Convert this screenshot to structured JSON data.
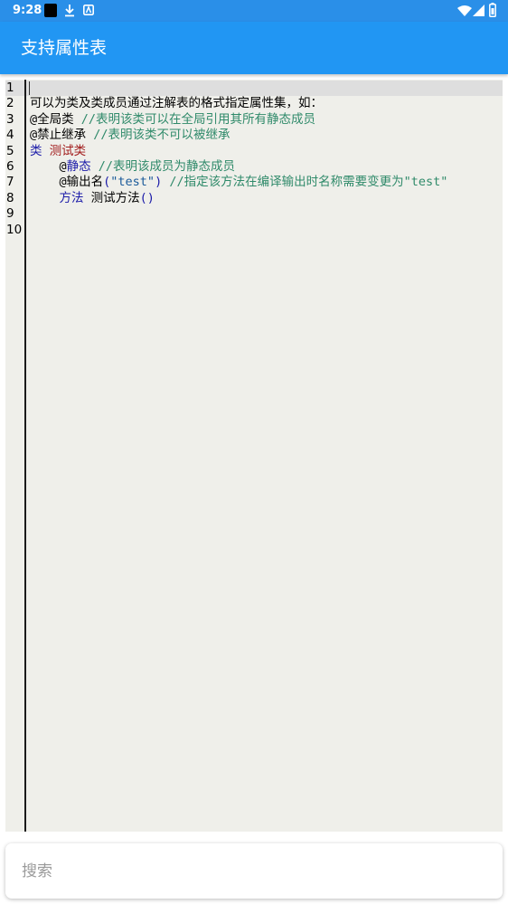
{
  "status_bar": {
    "time": "9:28",
    "icons": [
      "black-square-icon",
      "download-icon",
      "accessibility-icon",
      "wifi-icon",
      "signal-icon",
      "battery-icon"
    ]
  },
  "app_bar": {
    "title": "支持属性表"
  },
  "editor": {
    "current_line": 1,
    "lines": [
      {
        "num": "1",
        "tokens": []
      },
      {
        "num": "2",
        "tokens": [
          {
            "t": "可以为类及类成员通过注解表的格式指定属性集，如：",
            "c": "plain"
          }
        ]
      },
      {
        "num": "3",
        "tokens": [
          {
            "t": "@全局类 ",
            "c": "plain"
          },
          {
            "t": "//表明该类可以在全局引用其所有静态成员",
            "c": "comment"
          }
        ]
      },
      {
        "num": "4",
        "tokens": [
          {
            "t": "@禁止继承 ",
            "c": "plain"
          },
          {
            "t": "//表明该类不可以被继承",
            "c": "comment"
          }
        ]
      },
      {
        "num": "5",
        "tokens": [
          {
            "t": "类",
            "c": "keyword"
          },
          {
            "t": " ",
            "c": "plain"
          },
          {
            "t": "测试类",
            "c": "class"
          }
        ]
      },
      {
        "num": "6",
        "tokens": [
          {
            "t": "    @",
            "c": "plain"
          },
          {
            "t": "静态",
            "c": "keyword"
          },
          {
            "t": " ",
            "c": "plain"
          },
          {
            "t": "//表明该成员为静态成员",
            "c": "comment"
          }
        ]
      },
      {
        "num": "7",
        "tokens": [
          {
            "t": "    @输出名",
            "c": "plain"
          },
          {
            "t": "(",
            "c": "keyword"
          },
          {
            "t": "\"test\"",
            "c": "string"
          },
          {
            "t": ")",
            "c": "keyword"
          },
          {
            "t": " ",
            "c": "plain"
          },
          {
            "t": "//指定该方法在编译输出时名称需要变更为\"test\"",
            "c": "comment"
          }
        ]
      },
      {
        "num": "8",
        "tokens": [
          {
            "t": "    ",
            "c": "plain"
          },
          {
            "t": "方法",
            "c": "keyword"
          },
          {
            "t": " 测试方法",
            "c": "plain"
          },
          {
            "t": "()",
            "c": "keyword"
          }
        ]
      },
      {
        "num": "9",
        "tokens": []
      },
      {
        "num": "10",
        "tokens": []
      }
    ]
  },
  "search": {
    "placeholder": "搜索",
    "value": ""
  },
  "colors": {
    "status_bar": "#2a8fe8",
    "app_bar": "#2196f3",
    "editor_bg": "#efefea",
    "comment": "#2f8a6a",
    "keyword": "#1a1aa8",
    "class_name": "#a11b1b",
    "string": "#1a5a9a"
  }
}
